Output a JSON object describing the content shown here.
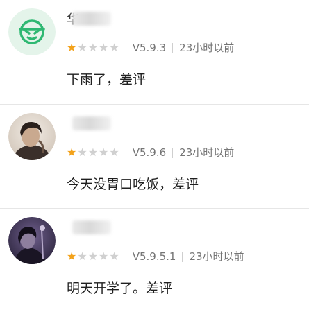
{
  "reviews": [
    {
      "avatar_icon": "cool-face-icon",
      "user_name_visible": "华",
      "rating": 1,
      "max_rating": 5,
      "version": "V5.9.3",
      "time": "23小时以前",
      "comment": "下雨了，差评"
    },
    {
      "avatar_icon": "person-photo",
      "user_name_visible": "",
      "rating": 1,
      "max_rating": 5,
      "version": "V5.9.6",
      "time": "23小时以前",
      "comment": "今天没胃口吃饭，差评"
    },
    {
      "avatar_icon": "person-photo-dark",
      "user_name_visible": "",
      "rating": 1,
      "max_rating": 5,
      "version": "V5.9.5.1",
      "time": "23小时以前",
      "comment": "明天开学了。差评"
    }
  ],
  "colors": {
    "star_filled": "#f3a21b",
    "star_empty": "#d0d0d0",
    "avatar_green_bg": "#e4f4ea",
    "avatar_green_icon": "#2eb872"
  }
}
